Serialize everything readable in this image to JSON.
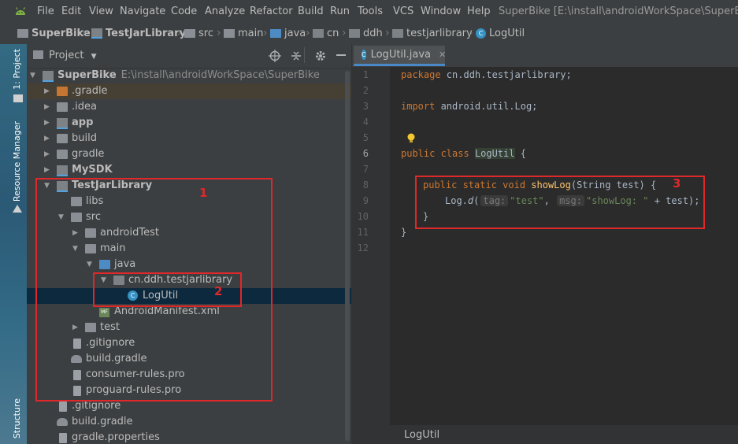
{
  "menubar": {
    "items": [
      "File",
      "Edit",
      "View",
      "Navigate",
      "Code",
      "Analyze",
      "Refactor",
      "Build",
      "Run",
      "Tools",
      "VCS",
      "Window",
      "Help"
    ],
    "window_title": "SuperBike [E:\\install\\androidWorkSpace\\SuperBike]"
  },
  "breadcrumb": [
    "SuperBike",
    "TestJarLibrary",
    "src",
    "main",
    "java",
    "cn",
    "ddh",
    "testjarlibrary",
    "LogUtil"
  ],
  "left_strip": {
    "project_tab": "1: Project",
    "resource_manager_tab": "Resource Manager",
    "structure_tab": "Structure"
  },
  "project_panel": {
    "view_selector": "Project",
    "tree": [
      {
        "label": "SuperBike",
        "path": "E:\\install\\androidWorkSpace\\SuperBike"
      },
      {
        "label": ".gradle"
      },
      {
        "label": ".idea"
      },
      {
        "label": "app"
      },
      {
        "label": "build"
      },
      {
        "label": "gradle"
      },
      {
        "label": "MySDK"
      },
      {
        "label": "TestJarLibrary"
      },
      {
        "label": "libs"
      },
      {
        "label": "src"
      },
      {
        "label": "androidTest"
      },
      {
        "label": "main"
      },
      {
        "label": "java"
      },
      {
        "label": "cn.ddh.testjarlibrary"
      },
      {
        "label": "LogUtil"
      },
      {
        "label": "AndroidManifest.xml"
      },
      {
        "label": "test"
      },
      {
        "label": ".gitignore"
      },
      {
        "label": "build.gradle"
      },
      {
        "label": "consumer-rules.pro"
      },
      {
        "label": "proguard-rules.pro"
      },
      {
        "label": ".gitignore"
      },
      {
        "label": "build.gradle"
      },
      {
        "label": "gradle.properties"
      }
    ]
  },
  "editor": {
    "tab_label": "LogUtil.java",
    "line_numbers": [
      "1",
      "2",
      "3",
      "4",
      "5",
      "6",
      "7",
      "8",
      "9",
      "10",
      "11",
      "12"
    ],
    "code": {
      "kw_package": "package",
      "package_name": " cn.ddh.testjarlibrary;",
      "kw_import": "import",
      "import_name": " android.util.Log;",
      "kw_public_class": "public class ",
      "class_name": "LogUtil",
      "class_open": " {",
      "kw_method": "public static void ",
      "method_name": "showLog",
      "method_params": "(String test) {",
      "log_call": "Log.",
      "log_d": "d",
      "paren_open": "(",
      "hint_tag": "tag:",
      "str_tag": "\"test\"",
      "comma": ", ",
      "hint_msg": "msg:",
      "str_msg": "\"showLog: \"",
      "concat": " + test);",
      "brace_close_inner": "}",
      "brace_close_outer": "}"
    },
    "breadcrumb_footer": "LogUtil"
  },
  "annotations": [
    "1",
    "2",
    "3"
  ],
  "colors": {
    "highlight_red": "#e0282a",
    "selection": "#0d293e",
    "keyword": "#cc7832",
    "string": "#6a8759"
  }
}
